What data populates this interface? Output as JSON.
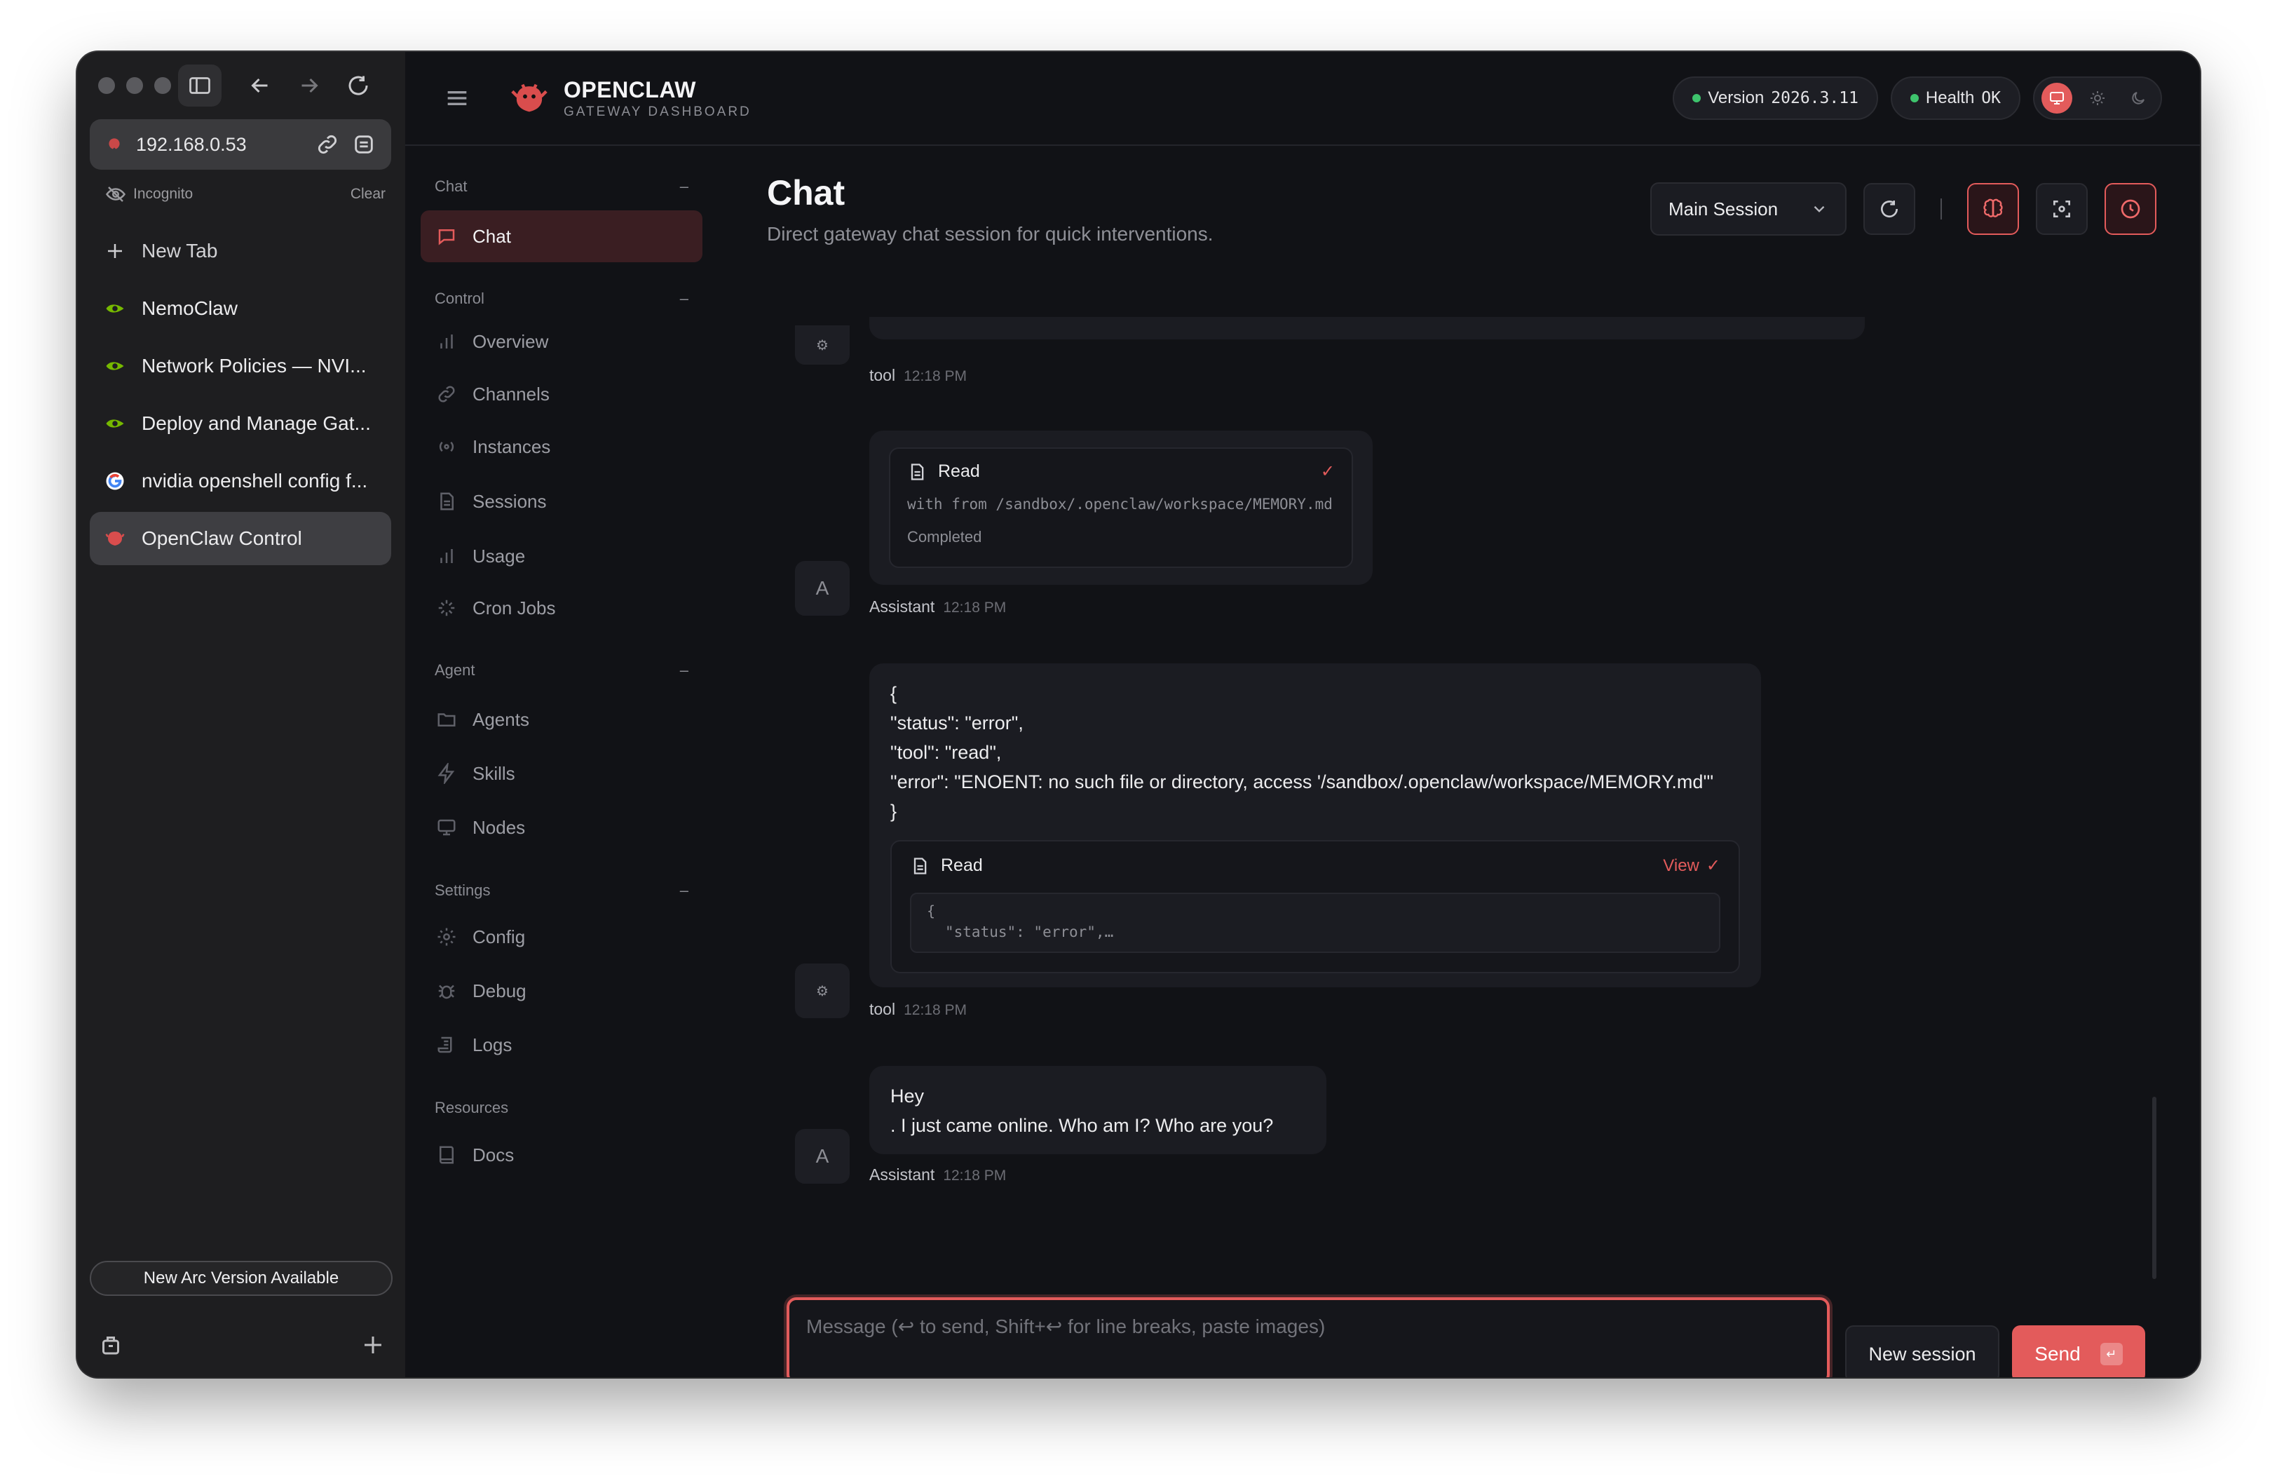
{
  "browser": {
    "url": "192.168.0.53",
    "incognito_label": "Incognito",
    "clear_label": "Clear",
    "new_tab_label": "New Tab",
    "tabs": [
      {
        "label": "NemoClaw",
        "icon": "nvidia-icon"
      },
      {
        "label": "Network Policies — NVI...",
        "icon": "nvidia-icon"
      },
      {
        "label": "Deploy and Manage Gat...",
        "icon": "nvidia-icon"
      },
      {
        "label": "nvidia openshell config f...",
        "icon": "google-icon"
      },
      {
        "label": "OpenClaw Control",
        "icon": "openclaw-icon",
        "active": true
      }
    ],
    "update_label": "New Arc Version Available"
  },
  "header": {
    "brand_name": "OPENCLAW",
    "brand_sub": "GATEWAY DASHBOARD",
    "version_label": "Version",
    "version_value": "2026.3.11",
    "health_label": "Health",
    "health_value": "OK"
  },
  "nav": {
    "sections": [
      {
        "title": "Chat",
        "items": [
          "Chat"
        ]
      },
      {
        "title": "Control",
        "items": [
          "Overview",
          "Channels",
          "Instances",
          "Sessions",
          "Usage",
          "Cron Jobs"
        ]
      },
      {
        "title": "Agent",
        "items": [
          "Agents",
          "Skills",
          "Nodes"
        ]
      },
      {
        "title": "Settings",
        "items": [
          "Config",
          "Debug",
          "Logs"
        ]
      },
      {
        "title": "Resources",
        "items": [
          "Docs"
        ]
      }
    ],
    "collapse_glyph": "–"
  },
  "main": {
    "title": "Chat",
    "subtitle": "Direct gateway chat session for quick interventions.",
    "session_select": "Main Session"
  },
  "messages": {
    "tool_1": {
      "sender": "tool",
      "time": "12:18 PM"
    },
    "read_card": {
      "title": "Read",
      "detail": "with from /sandbox/.openclaw/workspace/MEMORY.md",
      "status": "Completed"
    },
    "assistant_1": {
      "sender": "Assistant",
      "time": "12:18 PM",
      "avatar": "A"
    },
    "json_block": [
      "{",
      "\"status\": \"error\",",
      "\"tool\": \"read\",",
      "\"error\": \"ENOENT: no such file or directory, access '/sandbox/.openclaw/workspace/MEMORY.md'\"",
      "}"
    ],
    "read_card_2": {
      "title": "Read",
      "view_label": "View",
      "preview_1": "{",
      "preview_2": "\"status\": \"error\",…"
    },
    "tool_2": {
      "sender": "tool",
      "time": "12:18 PM"
    },
    "assistant_2": {
      "sender": "Assistant",
      "time": "12:18 PM",
      "avatar": "A",
      "line_1": "Hey",
      "line_2": ". I just came online. Who am I? Who are you?"
    }
  },
  "composer": {
    "placeholder": "Message (↩ to send, Shift+↩ for line breaks, paste images)",
    "new_session_label": "New session",
    "send_label": "Send",
    "send_kbd": "↵"
  },
  "colors": {
    "accent": "#e35b5b",
    "ok": "#3ec46d",
    "background": "#111216"
  }
}
